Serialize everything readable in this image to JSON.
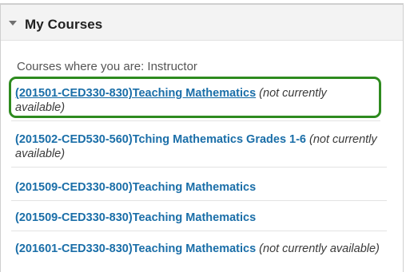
{
  "module": {
    "title": "My Courses",
    "role_heading": "Courses where you are: Instructor"
  },
  "courses": [
    {
      "title": "(201501-CED330-830)Teaching Mathematics",
      "status": "(not currently available)",
      "highlighted": true
    },
    {
      "title": "(201502-CED530-560)Tching Mathematics Grades 1-6",
      "status": "(not currently available)"
    },
    {
      "title": "(201509-CED330-800)Teaching Mathematics",
      "status": ""
    },
    {
      "title": "(201509-CED330-830)Teaching Mathematics",
      "status": ""
    },
    {
      "title": "(201601-CED330-830)Teaching Mathematics",
      "status": "(not currently available)"
    }
  ],
  "colors": {
    "link": "#1a6ea8",
    "highlight": "#2e8b1f",
    "header_bg": "#f3f3f3"
  },
  "icons": {
    "collapse": "triangle-down-icon"
  }
}
